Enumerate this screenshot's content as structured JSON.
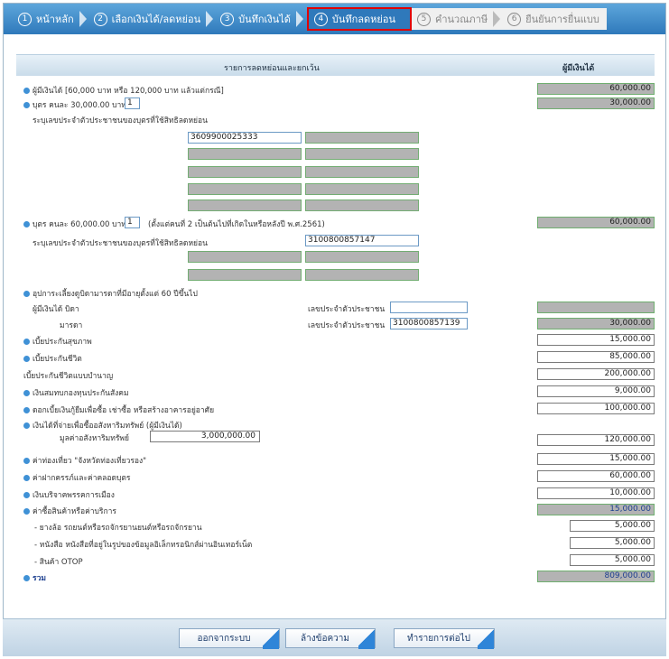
{
  "steps": [
    {
      "num": "1",
      "label": "หน้าหลัก"
    },
    {
      "num": "2",
      "label": "เลือกเงินได้/ลดหย่อน"
    },
    {
      "num": "3",
      "label": "บันทึกเงินได้"
    },
    {
      "num": "4",
      "label": "บันทึกลดหย่อน"
    },
    {
      "num": "5",
      "label": "คำนวณภาษี"
    },
    {
      "num": "6",
      "label": "ยืนยันการยื่นแบบ"
    }
  ],
  "header": {
    "col1": "รายการลดหย่อนและยกเว้น",
    "col2": "ผู้มีเงินได้"
  },
  "rows": {
    "taxpayer": {
      "label": "ผู้มีเงินได้ [60,000 บาท หรือ 120,000 บาท แล้วแต่กรณี]",
      "amount": "60,000.00"
    },
    "child30": {
      "label_pre": "บุตร คนละ 30,000.00 บาท",
      "count": "1",
      "amount": "30,000.00"
    },
    "id_label1": "ระบุเลขประจำตัวประชาชนของบุตรที่ใช้สิทธิลดหย่อน",
    "child_id1": "3609900025333",
    "child60": {
      "label_pre": "บุตร คนละ 60,000.00 บาท",
      "count": "1",
      "label_post": "(ตั้งแต่คนที่ 2 เป็นต้นไปที่เกิดในหรือหลังปี พ.ศ.2561)",
      "amount": "60,000.00"
    },
    "id_label2": "ระบุเลขประจำตัวประชาชนของบุตรที่ใช้สิทธิลดหย่อน",
    "child_id2": "3100800857147",
    "parents": {
      "label": "อุปการะเลี้ยงดูบิดามารดาที่มีอายุตั้งแต่ 60 ปีขึ้นไป"
    },
    "father": {
      "label": "ผู้มีเงินได้ บิดา",
      "id_label": "เลขประจำตัวประชาชน",
      "id": ""
    },
    "mother": {
      "label": "มารดา",
      "id_label": "เลขประจำตัวประชาชน",
      "id": "3100800857139",
      "amount": "30,000.00"
    },
    "health": {
      "label": "เบี้ยประกันสุขภาพ",
      "amount": "15,000.00"
    },
    "life": {
      "label": "เบี้ยประกันชีวิต",
      "amount": "85,000.00"
    },
    "pension": {
      "label": "เบี้ยประกันชีวิตแบบบำนาญ",
      "amount": "200,000.00"
    },
    "social": {
      "label": "เงินสมทบกองทุนประกันสังคม",
      "amount": "9,000.00"
    },
    "interest": {
      "label": "ดอกเบี้ยเงินกู้ยืมเพื่อซื้อ เช่าซื้อ หรือสร้างอาคารอยู่อาศัย",
      "amount": "100,000.00"
    },
    "property": {
      "label": "เงินได้ที่จ่ายเพื่อซื้ออสังหาริมทรัพย์ (ผู้มีเงินได้)",
      "sub_label": "มูลค่าอสังหาริมทรัพย์",
      "value": "3,000,000.00",
      "amount": "120,000.00"
    },
    "travel": {
      "label": "ค่าท่องเที่ยว \"จังหวัดท่องเที่ยวรอง\"",
      "amount": "15,000.00"
    },
    "prenatal": {
      "label": "ค่าฝากครรภ์และค่าคลอดบุตร",
      "amount": "60,000.00"
    },
    "party": {
      "label": "เงินบริจาคพรรคการเมือง",
      "amount": "10,000.00"
    },
    "goods": {
      "label": "ค่าซื้อสินค้าหรือค่าบริการ",
      "amount": "15,000.00"
    },
    "tires": {
      "label": "- ยางล้อ รถยนต์หรือรถจักรยานยนต์หรือรถจักรยาน",
      "amount": "5,000.00"
    },
    "ebook": {
      "label": "- หนังสือ หนังสือที่อยู่ในรูปของข้อมูลอิเล็กทรอนิกส์ผ่านอินเทอร์เน็ต",
      "amount": "5,000.00"
    },
    "otop": {
      "label": "- สินค้า OTOP",
      "amount": "5,000.00"
    },
    "total": {
      "label": "รวม",
      "amount": "809,000.00"
    }
  },
  "buttons": {
    "exit": "ออกจากระบบ",
    "clear": "ล้างข้อความ",
    "next": "ทำรายการต่อไป"
  }
}
